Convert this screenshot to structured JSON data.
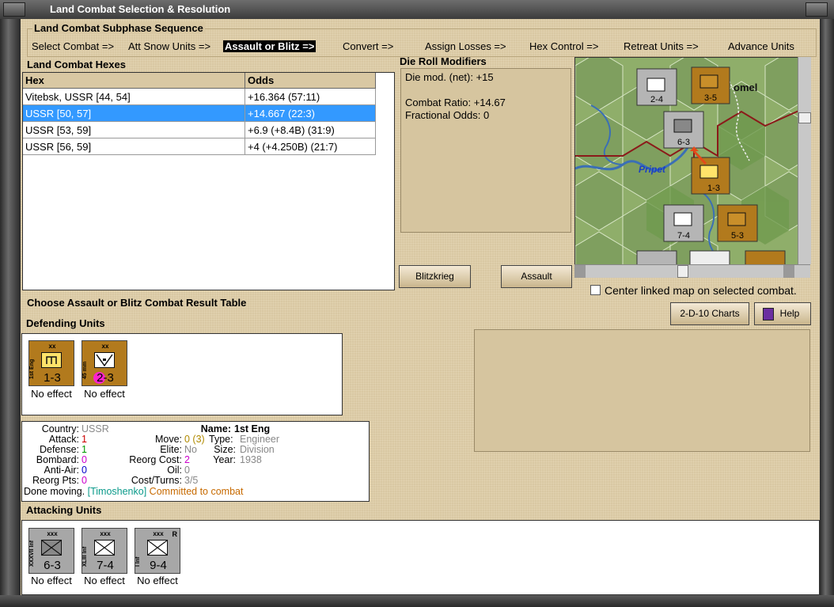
{
  "window": {
    "title": "Land Combat Selection & Resolution"
  },
  "subphase": {
    "heading": "Land Combat Subphase Sequence",
    "steps": [
      {
        "label": "Select Combat =>"
      },
      {
        "label": "Att Snow Units =>"
      },
      {
        "label": "Assault or Blitz =>"
      },
      {
        "label": "Convert =>"
      },
      {
        "label": "Assign Losses =>"
      },
      {
        "label": "Hex Control =>"
      },
      {
        "label": "Retreat Units =>"
      },
      {
        "label": "Advance Units"
      }
    ],
    "active_index": 2
  },
  "hexes": {
    "heading": "Land Combat Hexes",
    "col_hex": "Hex",
    "col_odds": "Odds",
    "rows": [
      {
        "hex": "Vitebsk, USSR [44, 54]",
        "odds": "+16.364 (57:11)"
      },
      {
        "hex": "USSR [50, 57]",
        "odds": "+14.667 (22:3)"
      },
      {
        "hex": "USSR [53, 59]",
        "odds": "+6.9 (+8.4B) (31:9)"
      },
      {
        "hex": "USSR [56, 59]",
        "odds": "+4 (+4.250B) (21:7)"
      }
    ],
    "selected_index": 1
  },
  "modifiers": {
    "heading": "Die Roll Modifiers",
    "line1": "Die mod. (net): +15",
    "line2": "Combat Ratio: +14.67",
    "line3": "Fractional Odds: 0"
  },
  "buttons": {
    "blitz": "Blitzkrieg",
    "assault": "Assault",
    "charts": "2-D-10 Charts",
    "help": "Help"
  },
  "map": {
    "river_label": "Pripet",
    "city_label": "omel",
    "checkbox_label": "Center linked map on selected combat.",
    "checkbox_checked": false
  },
  "choose_label": "Choose Assault or Blitz Combat Result Table",
  "defending": {
    "heading": "Defending Units",
    "units": [
      {
        "size": "xx",
        "name": "1st Eng",
        "strength": "1-3",
        "effect": "No effect",
        "color": "gold",
        "symbol": "engineer"
      },
      {
        "size": "xx",
        "name": "45 mm",
        "strength": "2-3",
        "effect": "No effect",
        "color": "gold",
        "symbol": "antitank"
      }
    ]
  },
  "info": {
    "country_label": "Country:",
    "country": "USSR",
    "name_label": "Name:",
    "name": "1st Eng",
    "attack_label": "Attack:",
    "attack": "1",
    "move_label": "Move:",
    "move": "0 (3)",
    "type_label": "Type:",
    "type": "Engineer",
    "defense_label": "Defense:",
    "defense": "1",
    "elite_label": "Elite:",
    "elite": "No",
    "size_label": "Size:",
    "size": "Division",
    "bombard_label": "Bombard:",
    "bombard": "0",
    "reorg_cost_label": "Reorg Cost:",
    "reorg_cost": "2",
    "year_label": "Year:",
    "year": "1938",
    "aa_label": "Anti-Air:",
    "aa": "0",
    "oil_label": "Oil:",
    "oil": "0",
    "reorg_pts_label": "Reorg Pts:",
    "reorg_pts": "0",
    "cost_turns_label": "Cost/Turns:",
    "cost_turns": "3/5",
    "status_done": "Done moving.",
    "status_leader": "[Timoshenko]",
    "status_committed": "Committed to combat"
  },
  "attacking": {
    "heading": "Attacking Units",
    "units": [
      {
        "size": "xxx",
        "name": "XXXVII Inf",
        "strength": "6-3",
        "effect": "No effect",
        "color": "grey",
        "flag": ""
      },
      {
        "size": "xxx",
        "name": "XLIII Inf",
        "strength": "7-4",
        "effect": "No effect",
        "color": "grey",
        "flag": ""
      },
      {
        "size": "xxx",
        "name": "I Inf",
        "strength": "9-4",
        "effect": "No effect",
        "color": "grey",
        "flag": "R"
      }
    ]
  },
  "colors": {
    "accent": "#3399ff",
    "tan": "#d9c8a3",
    "gold_counter": "#b27a1d",
    "grey_counter": "#a7a7a7"
  }
}
